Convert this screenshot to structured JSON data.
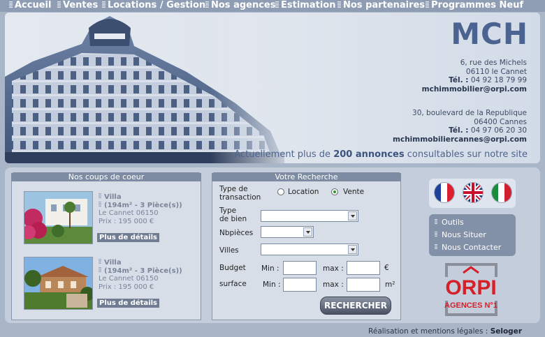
{
  "nav": [
    "Accueil",
    "Ventes",
    "Locations / Gestion",
    "Nos agences",
    "Estimation",
    "Nos partenaires",
    "Programmes Neuf"
  ],
  "brand": "MCH",
  "agency1": {
    "street": "6, rue des Michels",
    "city": "06110 le Cannet",
    "tel_label": "Tél. :",
    "tel": "04 92 18 79 99",
    "email": "mchimmobilier@orpi.com"
  },
  "agency2": {
    "street": "30, boulevard de la Republique",
    "city": "06400 Cannes",
    "tel_label": "Tél. :",
    "tel": "04 97 06 20 30",
    "email": "mchimmobiliercannes@orpi.com"
  },
  "tagline": {
    "before": "Actuellement plus de",
    "count": "200 annonces",
    "after": "consultables sur notre site"
  },
  "coups": {
    "title": "Nos coups de coeur",
    "items": [
      {
        "type": "Villa",
        "size": "(194m² - 3 Pièce(s))",
        "city": "Le Cannet 06150",
        "price": "Prix : 195 000 €",
        "btn": "Plus de détails"
      },
      {
        "type": "Villa",
        "size": "(194m² - 3 Pièce(s))",
        "city": "Le Cannet 06150",
        "price": "Prix : 195 000 €",
        "btn": "Plus de détails"
      }
    ]
  },
  "search": {
    "title": "Votre Recherche",
    "type_transaction_l1": "Type de",
    "type_transaction_l2": "transaction",
    "opt_location": "Location",
    "opt_vente": "Vente",
    "selected": "Vente",
    "type_bien_l1": "Type",
    "type_bien_l2": "de bien",
    "nb_pieces": "Nbpièces",
    "villes": "Villes",
    "budget": "Budget",
    "surface": "surface",
    "min": "Min :",
    "max": "max :",
    "currency": "€",
    "area_unit": "m²",
    "button": "RECHERCHER"
  },
  "side_links": [
    "Outils",
    "Nous Situer",
    "Nous Contacter"
  ],
  "flags": [
    "france-flag-icon",
    "uk-flag-icon",
    "italy-flag-icon"
  ],
  "orpi": {
    "name": "ORPI",
    "sub": "AGENCES N°1"
  },
  "footer": {
    "text": "Réalisation et mentions légales :",
    "link": "Seloger"
  },
  "colors": {
    "accent": "#4a6391",
    "nav_bg": "#8e9db3",
    "panel": "#c3cddb",
    "orpi_red": "#d5202a"
  }
}
